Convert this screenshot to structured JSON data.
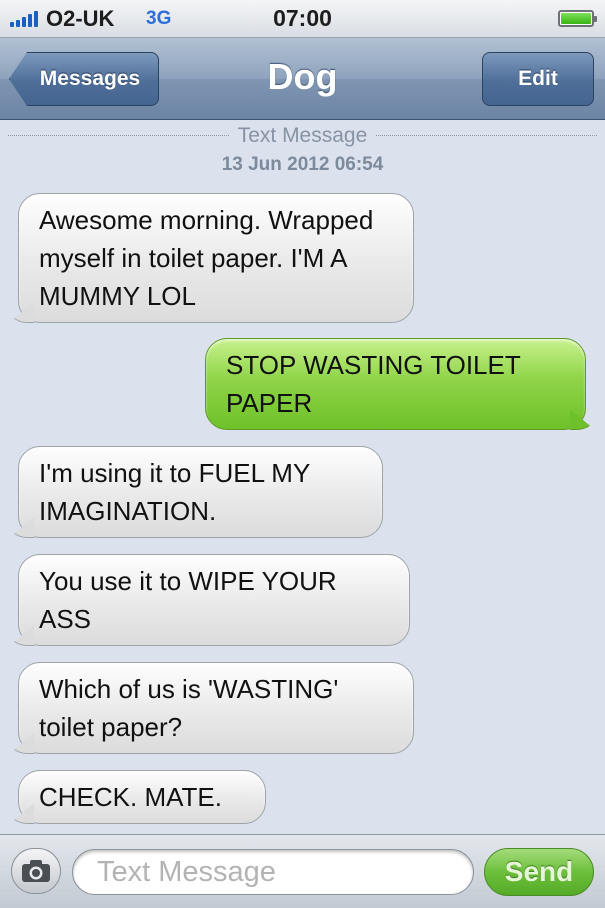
{
  "status_bar": {
    "carrier": "O2-UK",
    "network": "3G",
    "time": "07:00",
    "signal_bars": 5,
    "battery_level": 1.0,
    "icons": [
      "signal-strength-icon",
      "battery-icon"
    ]
  },
  "nav": {
    "back_label": "Messages",
    "title": "Dog",
    "edit_label": "Edit"
  },
  "conversation": {
    "header_label": "Text Message",
    "header_date": "13 Jun 2012 06:54",
    "messages": [
      {
        "direction": "incoming",
        "text": "Awesome morning. Wrapped myself in toilet paper. I'M A MUMMY LOL"
      },
      {
        "direction": "outgoing",
        "text": "STOP WASTING TOILET PAPER"
      },
      {
        "direction": "incoming",
        "text": "I'm using it to FUEL MY IMAGINATION."
      },
      {
        "direction": "incoming",
        "text": "You use it to WIPE YOUR ASS"
      },
      {
        "direction": "incoming",
        "text": "Which of us is 'WASTING' toilet paper?"
      },
      {
        "direction": "incoming",
        "text": "CHECK. MATE."
      }
    ]
  },
  "compose": {
    "placeholder": "Text Message",
    "value": "",
    "send_label": "Send",
    "camera_icon": "camera-icon"
  },
  "colors": {
    "incoming_bubble": "#e9e9e9",
    "outgoing_bubble": "#8fd447",
    "background": "#dbe2ed",
    "nav_bar": "#7f96b2",
    "send_button": "#6cbf3b"
  }
}
